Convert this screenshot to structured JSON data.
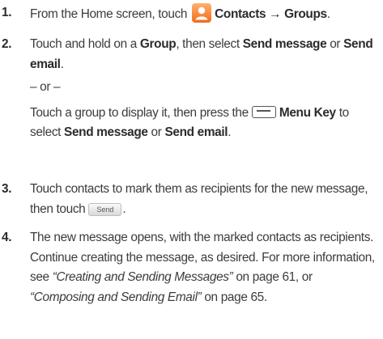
{
  "steps": [
    {
      "number": "1.",
      "intro": "From the Home screen, touch",
      "icon": "contacts-app-icon",
      "target": "Contacts → Groups",
      "end": "."
    },
    {
      "number": "2.",
      "a1": "Touch and hold on a ",
      "group": "Group",
      "a2": ", then select ",
      "send_message": "Send message",
      "a3": " or ",
      "send_email": "Send email",
      "a4": ".",
      "or": "– or –",
      "b1": "Touch a group to display it, then press the",
      "menu_icon": "menu-key-icon",
      "menu_key": "Menu Key",
      "b2": " to select ",
      "b3": " or ",
      "b4": "."
    },
    {
      "number": "3.",
      "text": "Touch contacts to mark them as recipients for the new message, then touch",
      "send_button": "Send",
      "end": "."
    },
    {
      "number": "4.",
      "t1": "The new message opens, with the marked contacts as recipients. Continue creating the message, as desired. For more information, see ",
      "ref1": "“Creating and Sending Messages”",
      "t2": " on page 61, or ",
      "ref2": "“Composing and Sending Email”",
      "t3": " on page 65."
    }
  ]
}
